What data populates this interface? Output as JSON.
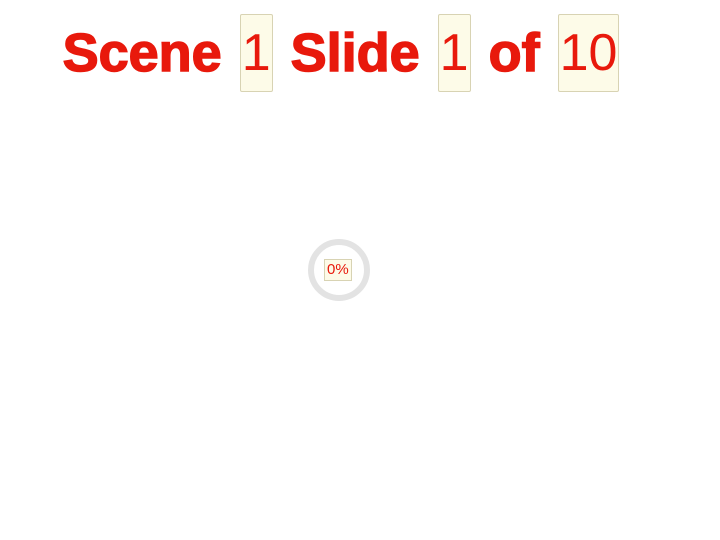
{
  "title": {
    "scene_label": "Scene",
    "scene_number": "1",
    "slide_label": "Slide",
    "slide_number": "1",
    "of_label": "of",
    "total_slides": "10"
  },
  "loader": {
    "progress_text": "0%",
    "progress_fraction": 0
  },
  "colors": {
    "title_red": "#e8190c",
    "box_fill": "#fdfbe8",
    "box_border": "#d8d3b3",
    "ring": "#e3e3e3"
  }
}
